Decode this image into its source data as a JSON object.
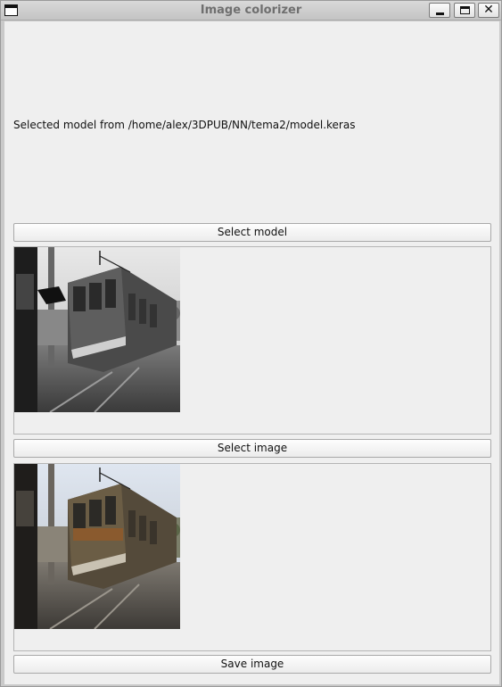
{
  "window": {
    "title": "Image colorizer",
    "minimize_glyph": "_",
    "maximize_glyph": "□",
    "close_glyph": "✕"
  },
  "status": {
    "model_text": "Selected model from /home/alex/3DPUB/NN/tema2/model.keras"
  },
  "buttons": {
    "select_model": "Select model",
    "select_image": "Select image",
    "save_image": "Save image"
  },
  "images": {
    "input_description_icon": "grayscale-tram-photo",
    "output_description_icon": "colorized-tram-photo"
  }
}
